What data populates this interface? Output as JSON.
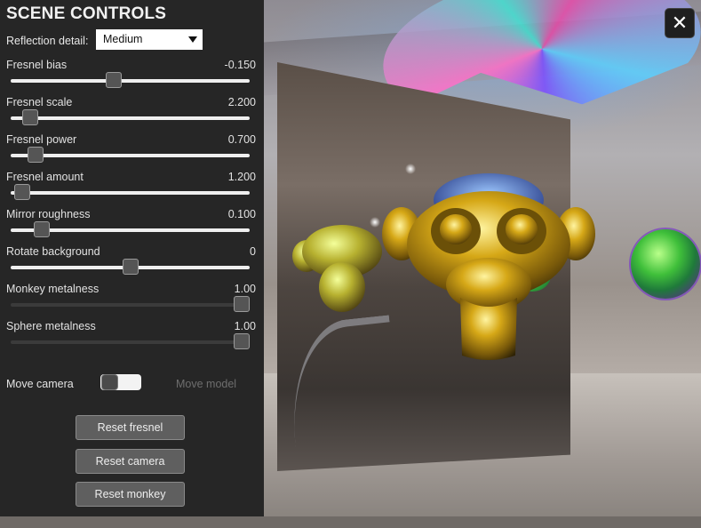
{
  "panel": {
    "title": "SCENE CONTROLS",
    "reflection": {
      "label": "Reflection detail:",
      "selected": "Medium"
    },
    "sliders": [
      {
        "label": "Fresnel bias",
        "value": "-0.150",
        "level": 0.43,
        "dim": false
      },
      {
        "label": "Fresnel scale",
        "value": "2.200",
        "level": 0.08,
        "dim": false
      },
      {
        "label": "Fresnel power",
        "value": "0.700",
        "level": 0.105,
        "dim": false
      },
      {
        "label": "Fresnel amount",
        "value": "1.200",
        "level": 0.05,
        "dim": false
      },
      {
        "label": "Mirror roughness",
        "value": "0.100",
        "level": 0.13,
        "dim": false
      },
      {
        "label": "Rotate background",
        "value": "0",
        "level": 0.5,
        "dim": false
      },
      {
        "label": "Monkey metalness",
        "value": "1.00",
        "level": 0.965,
        "dim": true
      },
      {
        "label": "Sphere metalness",
        "value": "1.00",
        "level": 0.965,
        "dim": true
      }
    ],
    "camera_toggle": {
      "label": "Move camera",
      "alt_label": "Move model",
      "on": false
    },
    "buttons": {
      "reset_fresnel": "Reset fresnel",
      "reset_camera": "Reset camera",
      "reset_monkey": "Reset monkey"
    }
  },
  "viewport": {
    "close_icon": "close-icon"
  }
}
